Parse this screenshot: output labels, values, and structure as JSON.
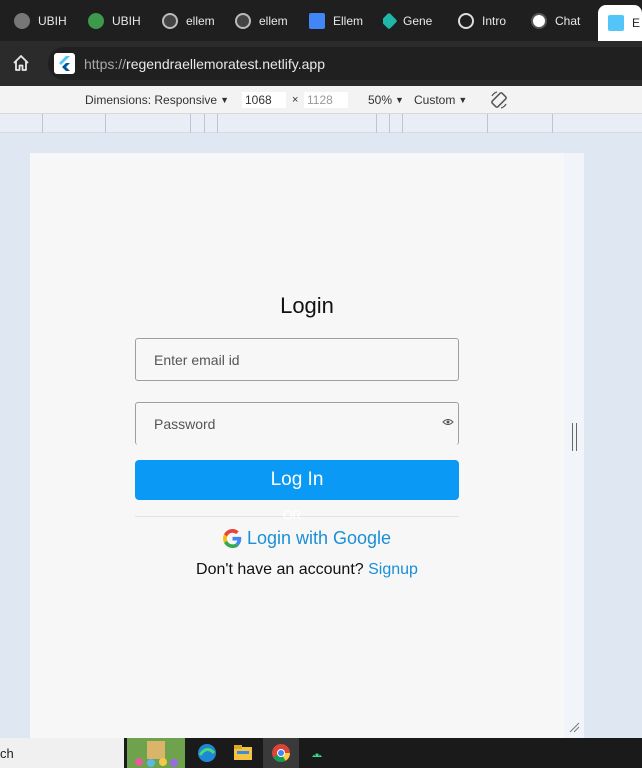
{
  "browser": {
    "tabs": [
      {
        "label": "UBIH",
        "icon": "globe-icon"
      },
      {
        "label": "UBIH",
        "icon": "clover-icon"
      },
      {
        "label": "ellem",
        "icon": "github-icon"
      },
      {
        "label": "ellem",
        "icon": "github-icon"
      },
      {
        "label": "Ellem",
        "icon": "doc-icon"
      },
      {
        "label": "Gene",
        "icon": "gemini-icon"
      },
      {
        "label": "Intro",
        "icon": "openai-icon"
      },
      {
        "label": "Chat",
        "icon": "openai-icon"
      },
      {
        "label": "E",
        "icon": "flutter-icon",
        "active": true
      }
    ],
    "url_protocol": "https://",
    "url_host": "regendraellemoratest.netlify.app"
  },
  "devtools": {
    "dimensions_label": "Dimensions: Responsive",
    "width": "1068",
    "height": "1128",
    "times": "×",
    "zoom": "50%",
    "throttle": "Custom"
  },
  "app": {
    "title": "Login",
    "email_placeholder": "Enter email id",
    "password_placeholder": "Password",
    "login_button": "Log In",
    "or_text": "OR",
    "google_login": "Login with Google",
    "no_account_text": "Don't have an account?",
    "signup_link": "Signup"
  },
  "taskbar": {
    "search_fragment": "ch"
  }
}
